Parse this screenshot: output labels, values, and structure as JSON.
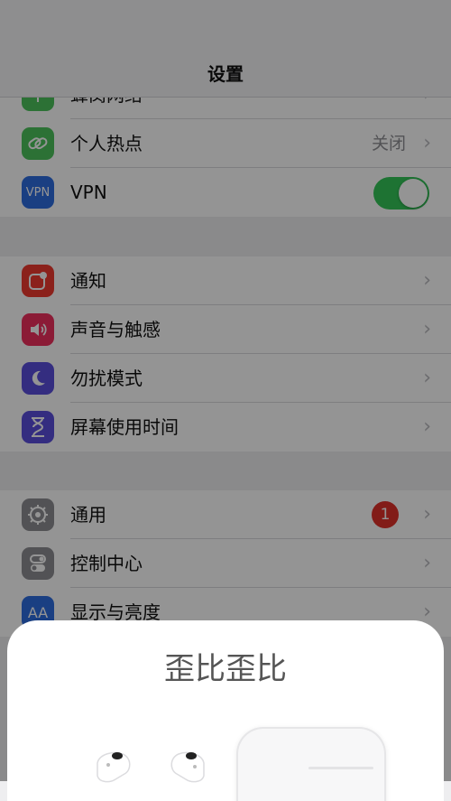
{
  "header": {
    "title": "设置"
  },
  "group1": {
    "items": [
      {
        "label": "蜂窝网络",
        "icon": "cellular-antenna-icon",
        "color": "#4cc35c"
      },
      {
        "label": "个人热点",
        "icon": "hotspot-link-icon",
        "color": "#4cc35c",
        "value": "关闭"
      },
      {
        "label": "VPN",
        "icon": "vpn-icon",
        "color": "#2e6de0",
        "icon_text": "VPN",
        "toggle": "on"
      }
    ]
  },
  "group2": {
    "items": [
      {
        "label": "通知",
        "icon": "notification-icon",
        "color": "#f03a2f"
      },
      {
        "label": "声音与触感",
        "icon": "speaker-icon",
        "color": "#ef2f5e"
      },
      {
        "label": "勿扰模式",
        "icon": "moon-icon",
        "color": "#5b4fdc"
      },
      {
        "label": "屏幕使用时间",
        "icon": "hourglass-icon",
        "color": "#5b4fdc"
      }
    ]
  },
  "group3": {
    "items": [
      {
        "label": "通用",
        "icon": "gear-icon",
        "color": "#8e8e93",
        "badge": "1"
      },
      {
        "label": "控制中心",
        "icon": "toggles-icon",
        "color": "#8e8e93"
      },
      {
        "label": "显示与亮度",
        "icon": "text-size-icon",
        "color": "#2e6de0",
        "icon_text": "AA"
      }
    ]
  },
  "sheet": {
    "title": "歪比歪比"
  }
}
